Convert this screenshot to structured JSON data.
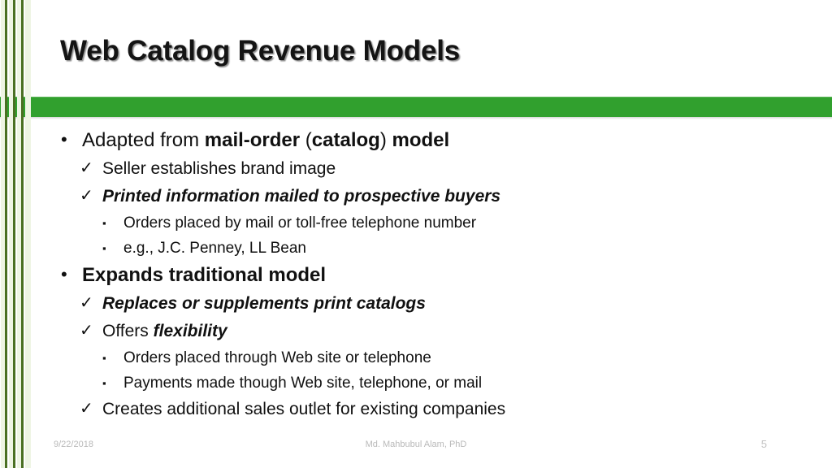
{
  "slide": {
    "title": "Web Catalog Revenue Models",
    "accent_color": "#31a02e",
    "stripe_color": "#4a7023",
    "content": [
      {
        "level": 1,
        "marker": "bullet-dot",
        "marker_glyph": "•",
        "runs": [
          {
            "text": "Adapted from ",
            "style": "normal"
          },
          {
            "text": "mail-order",
            "style": "bold"
          },
          {
            "text": " (",
            "style": "normal"
          },
          {
            "text": "catalog",
            "style": "bold"
          },
          {
            "text": ") ",
            "style": "normal"
          },
          {
            "text": "model",
            "style": "bold"
          }
        ]
      },
      {
        "level": 2,
        "marker": "checkmark",
        "marker_glyph": "✓",
        "runs": [
          {
            "text": "Seller establishes brand image",
            "style": "normal"
          }
        ]
      },
      {
        "level": 2,
        "marker": "checkmark",
        "marker_glyph": "✓",
        "runs": [
          {
            "text": "Printed information mailed to prospective buyers",
            "style": "bold-italic"
          }
        ]
      },
      {
        "level": 3,
        "marker": "square",
        "marker_glyph": "▪",
        "runs": [
          {
            "text": "Orders placed by mail or toll-free telephone number",
            "style": "normal"
          }
        ]
      },
      {
        "level": 3,
        "marker": "square",
        "marker_glyph": "▪",
        "runs": [
          {
            "text": "e.g., J.C. Penney, LL Bean",
            "style": "normal"
          }
        ]
      },
      {
        "level": 1,
        "marker": "bullet-dot",
        "marker_glyph": "•",
        "runs": [
          {
            "text": "Expands traditional model",
            "style": "bold"
          }
        ]
      },
      {
        "level": 2,
        "marker": "checkmark",
        "marker_glyph": "✓",
        "runs": [
          {
            "text": "Replaces or supplements print catalogs",
            "style": "bold-italic"
          }
        ]
      },
      {
        "level": 2,
        "marker": "checkmark",
        "marker_glyph": "✓",
        "runs": [
          {
            "text": "Offers ",
            "style": "normal"
          },
          {
            "text": "flexibility",
            "style": "bold-italic"
          }
        ]
      },
      {
        "level": 3,
        "marker": "square",
        "marker_glyph": "▪",
        "runs": [
          {
            "text": "Orders placed through Web site or telephone",
            "style": "normal"
          }
        ]
      },
      {
        "level": 3,
        "marker": "square",
        "marker_glyph": "▪",
        "runs": [
          {
            "text": "Payments made though Web site, telephone, or mail",
            "style": "normal"
          }
        ]
      },
      {
        "level": 2,
        "marker": "checkmark",
        "marker_glyph": "✓",
        "runs": [
          {
            "text": "Creates additional sales outlet for existing companies",
            "style": "normal"
          }
        ]
      }
    ]
  },
  "footer": {
    "date": "9/22/2018",
    "author": "Md. Mahbubul Alam, PhD",
    "page_number": "5"
  }
}
